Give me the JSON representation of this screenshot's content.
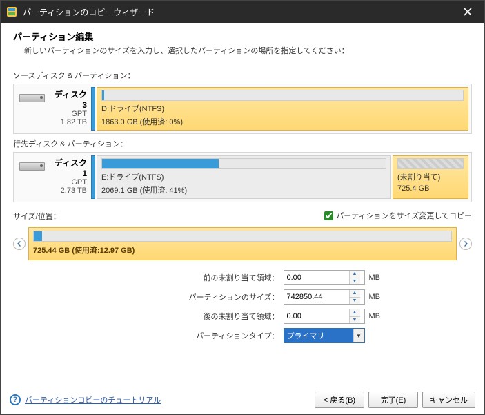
{
  "title_bar": {
    "title": "パーティションのコピーウィザード"
  },
  "header": {
    "title": "パーティション編集",
    "desc": "新しいパーティションのサイズを入力し、選択したパーティションの場所を指定してください："
  },
  "source": {
    "label": "ソースディスク & パーティション：",
    "disk_name": "ディスク 3",
    "disk_scheme": "GPT",
    "disk_size": "1.82 TB",
    "partition_name": "D:ドライブ(NTFS)",
    "partition_detail": "1863.0 GB (使用済: 0%)",
    "used_pct": 0
  },
  "target": {
    "label": "行先ディスク & パーティション：",
    "disk_name": "ディスク 1",
    "disk_scheme": "GPT",
    "disk_size": "2.73 TB",
    "partition_name": "E:ドライブ(NTFS)",
    "partition_detail": "2069.1 GB (使用済: 41%)",
    "used_pct": 41,
    "unalloc_label": "(未割り当て)",
    "unalloc_size": "725.4 GB"
  },
  "size_pos": {
    "label": "サイズ/位置：",
    "resize_checkbox": "パーティションをサイズ変更してコピー",
    "resize_checked": true,
    "slider_caption": "725.44 GB (使用済:12.97 GB)",
    "slider_used_pct": 2
  },
  "form": {
    "before_label": "前の未割り当て領域：",
    "before_value": "0.00",
    "partition_size_label": "パーティションのサイズ：",
    "partition_size_value": "742850.44",
    "after_label": "後の未割り当て領域：",
    "after_value": "0.00",
    "type_label": "パーティションタイプ：",
    "type_value": "プライマリ",
    "unit": "MB"
  },
  "footer": {
    "help_text": "パーティションコピーのチュートリアル",
    "back": "< 戻る(B)",
    "finish": "完了(E)",
    "cancel": "キャンセル"
  }
}
